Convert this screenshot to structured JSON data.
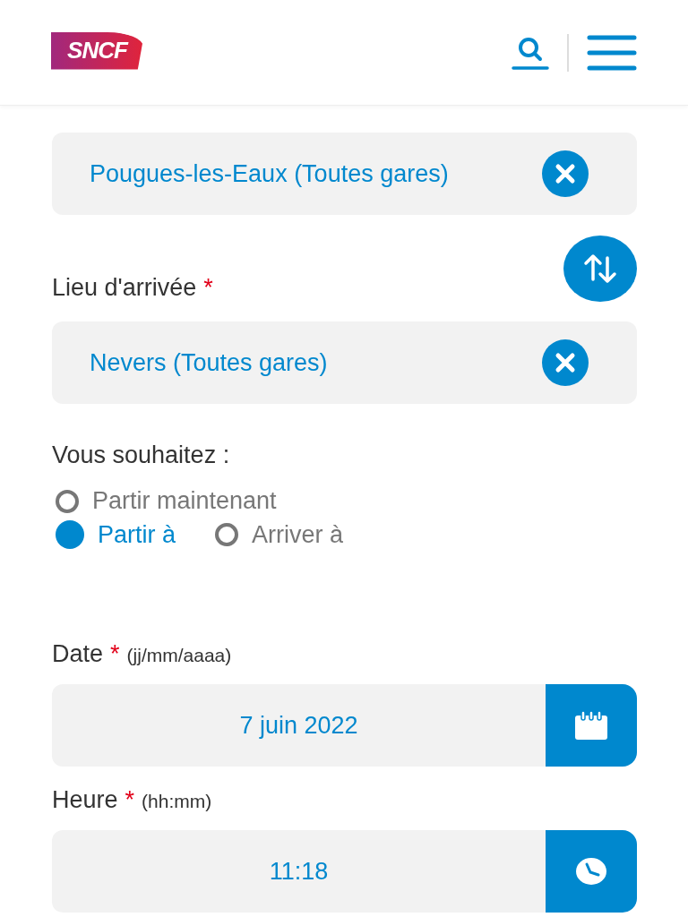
{
  "header": {
    "logo": "SNCF"
  },
  "departure": {
    "value": "Pougues-les-Eaux (Toutes gares)"
  },
  "arrival": {
    "label": "Lieu d'arrivée",
    "required_mark": "*",
    "value": "Nevers (Toutes gares)"
  },
  "wish": {
    "label": "Vous souhaitez :",
    "options": [
      {
        "label": "Partir maintenant",
        "selected": false
      },
      {
        "label": "Partir à",
        "selected": true
      },
      {
        "label": "Arriver à",
        "selected": false
      }
    ]
  },
  "date": {
    "label": "Date",
    "required_mark": "*",
    "hint": "(jj/mm/aaaa)",
    "value": "7 juin 2022"
  },
  "time": {
    "label": "Heure",
    "required_mark": "*",
    "hint": "(hh:mm)",
    "value": "11:18"
  }
}
